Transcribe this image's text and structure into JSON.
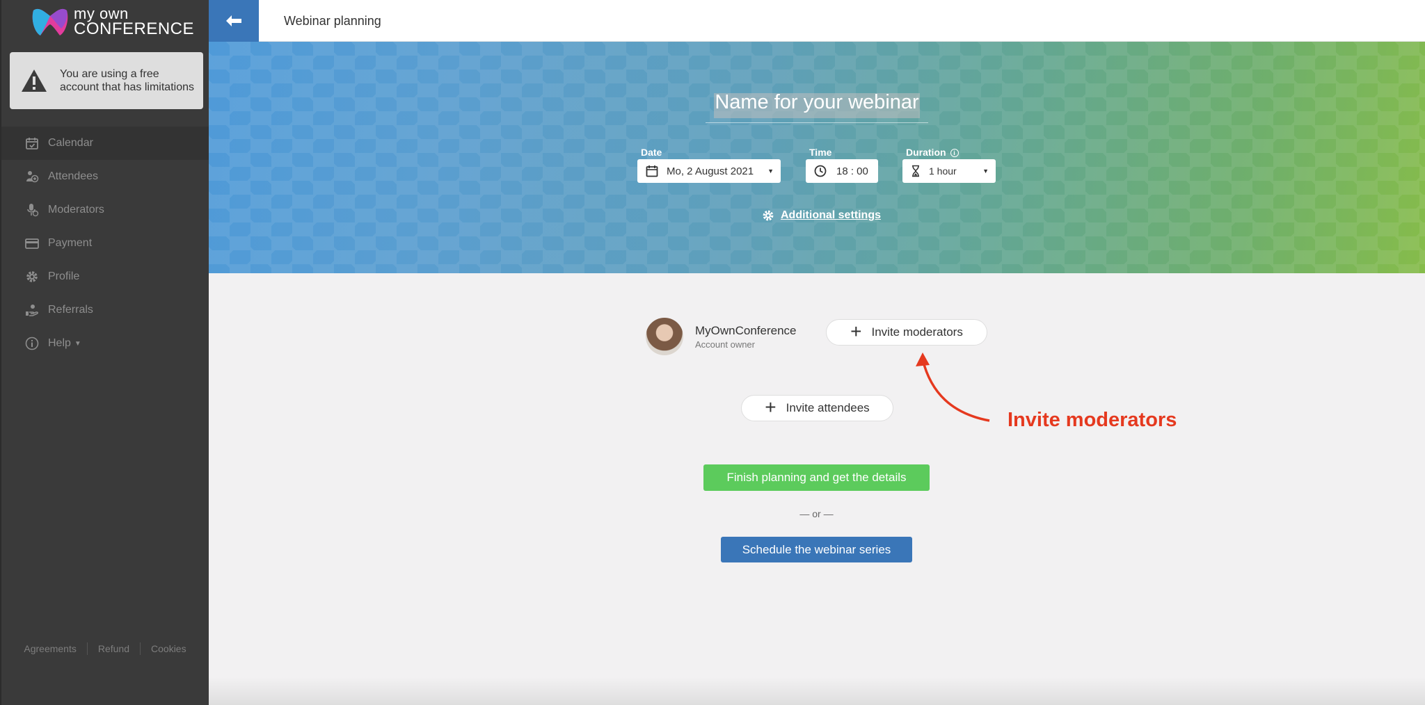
{
  "app": {
    "logo_line1": "my own",
    "logo_line2": "CONFERENCE"
  },
  "sidebar": {
    "notice": "You are using a free account that has limitations",
    "items": [
      {
        "label": "Calendar",
        "icon": "calendar-check-icon",
        "active": true
      },
      {
        "label": "Attendees",
        "icon": "attendees-icon"
      },
      {
        "label": "Moderators",
        "icon": "moderators-icon"
      },
      {
        "label": "Payment",
        "icon": "credit-card-icon"
      },
      {
        "label": "Profile",
        "icon": "gear-icon"
      },
      {
        "label": "Referrals",
        "icon": "referrals-hand-icon"
      },
      {
        "label": "Help",
        "icon": "info-circle-icon",
        "has_dropdown": true
      }
    ],
    "footer_links": [
      "Agreements",
      "Refund",
      "Cookies"
    ]
  },
  "topbar": {
    "title": "Webinar planning",
    "back_icon": "arrow-left-icon"
  },
  "hero": {
    "name_placeholder": "Name for your webinar",
    "date_label": "Date",
    "date_value": "Mo, 2 August 2021",
    "time_label": "Time",
    "time_value": "18 : 00",
    "duration_label": "Duration",
    "duration_value": "1 hour",
    "additional_settings": "Additional settings"
  },
  "main": {
    "owner_name": "MyOwnConference",
    "owner_role": "Account owner",
    "invite_moderators": "Invite moderators",
    "invite_attendees": "Invite attendees",
    "finish_button": "Finish planning and get the details",
    "or_text": "— or —",
    "schedule_button": "Schedule the webinar series",
    "annotation": "Invite moderators"
  },
  "colors": {
    "sidebar_bg": "#3a3a3a",
    "accent_blue": "#3a76b8",
    "accent_green": "#5ccb5c",
    "annotation_red": "#e5391f"
  }
}
